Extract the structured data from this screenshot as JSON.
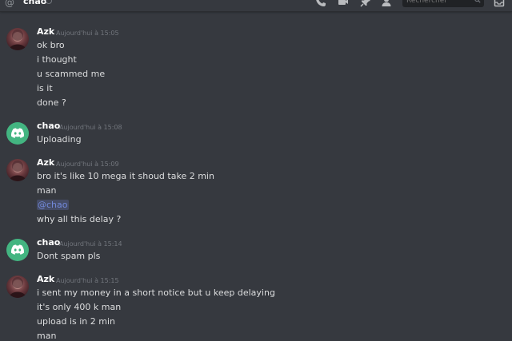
{
  "header": {
    "at_symbol": "@",
    "channel_name": "chao",
    "search_placeholder": "Rechercher",
    "icons": [
      "call-icon",
      "video-icon",
      "pin-icon",
      "member-list-icon",
      "search-icon",
      "inbox-icon"
    ]
  },
  "colors": {
    "background": "#36393f",
    "chao_avatar": "#43b581",
    "mention": "#7289da",
    "text": "#dcddde",
    "timestamp": "#72767d"
  },
  "messages": [
    {
      "author": "Azk",
      "timestamp": "Aujourd'hui à 15:05",
      "avatar": "azk-avatar",
      "lines": [
        "ok bro",
        "i thought",
        "u scammed me",
        "is it",
        "done ?"
      ]
    },
    {
      "author": "chao",
      "timestamp": "Aujourd'hui à 15:08",
      "avatar": "discord-avatar",
      "lines": [
        "Uploading"
      ]
    },
    {
      "author": "Azk",
      "timestamp": "Aujourd'hui à 15:09",
      "avatar": "azk-avatar",
      "lines": [
        "bro it's like 10 mega it shoud take 2 min",
        "man",
        "@chao",
        "why all this delay ?"
      ]
    },
    {
      "author": "chao",
      "timestamp": "Aujourd'hui à 15:14",
      "avatar": "discord-avatar",
      "lines": [
        "Dont spam pls"
      ]
    },
    {
      "author": "Azk",
      "timestamp": "Aujourd'hui à 15:15",
      "avatar": "azk-avatar",
      "lines": [
        "i sent my money in a short notice  but u keep  delaying",
        "it's only 400 k man",
        "upload is in 2 min",
        "man"
      ]
    }
  ]
}
